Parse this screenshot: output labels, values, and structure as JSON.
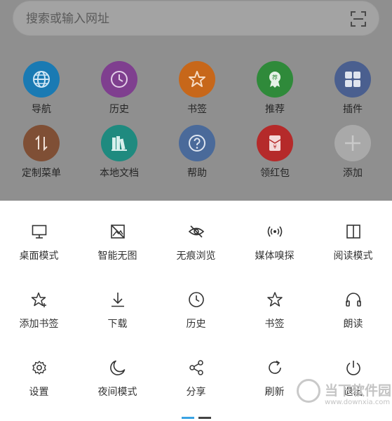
{
  "search": {
    "placeholder": "搜索或输入网址",
    "scan_icon": "scan-icon"
  },
  "apps": [
    {
      "label": "导航",
      "icon": "globe-icon",
      "color": "#1a7ab3"
    },
    {
      "label": "历史",
      "icon": "clock-icon",
      "color": "#7f3f8f"
    },
    {
      "label": "书签",
      "icon": "star-icon",
      "color": "#c7671a"
    },
    {
      "label": "推荐",
      "icon": "award-icon",
      "color": "#2f8a3a"
    },
    {
      "label": "插件",
      "icon": "grid-icon",
      "color": "#4a5f8f"
    },
    {
      "label": "定制菜单",
      "icon": "sort-arrows-icon",
      "color": "#7f4f35"
    },
    {
      "label": "本地文档",
      "icon": "books-icon",
      "color": "#1f8a7f"
    },
    {
      "label": "帮助",
      "icon": "question-icon",
      "color": "#4a6a9a"
    },
    {
      "label": "领红包",
      "icon": "red-packet-icon",
      "color": "#b52a2a"
    },
    {
      "label": "添加",
      "icon": "plus-icon",
      "color": "#a9a9a9"
    }
  ],
  "menu": [
    {
      "label": "桌面模式",
      "icon": "monitor-icon"
    },
    {
      "label": "智能无图",
      "icon": "no-image-icon"
    },
    {
      "label": "无痕浏览",
      "icon": "eye-off-icon"
    },
    {
      "label": "媒体嗅探",
      "icon": "broadcast-icon"
    },
    {
      "label": "阅读模式",
      "icon": "book-columns-icon"
    },
    {
      "label": "添加书签",
      "icon": "star-plus-icon"
    },
    {
      "label": "下载",
      "icon": "download-icon"
    },
    {
      "label": "历史",
      "icon": "clock-icon"
    },
    {
      "label": "书签",
      "icon": "star-outline-icon"
    },
    {
      "label": "朗读",
      "icon": "headphones-icon"
    },
    {
      "label": "设置",
      "icon": "gear-icon"
    },
    {
      "label": "夜间模式",
      "icon": "moon-icon"
    },
    {
      "label": "分享",
      "icon": "share-icon"
    },
    {
      "label": "刷新",
      "icon": "refresh-icon"
    },
    {
      "label": "退出",
      "icon": "power-icon"
    }
  ],
  "pager": {
    "pages": 2,
    "current": 1
  },
  "watermark": {
    "name": "当下软件园",
    "url": "www.downxia.com"
  }
}
